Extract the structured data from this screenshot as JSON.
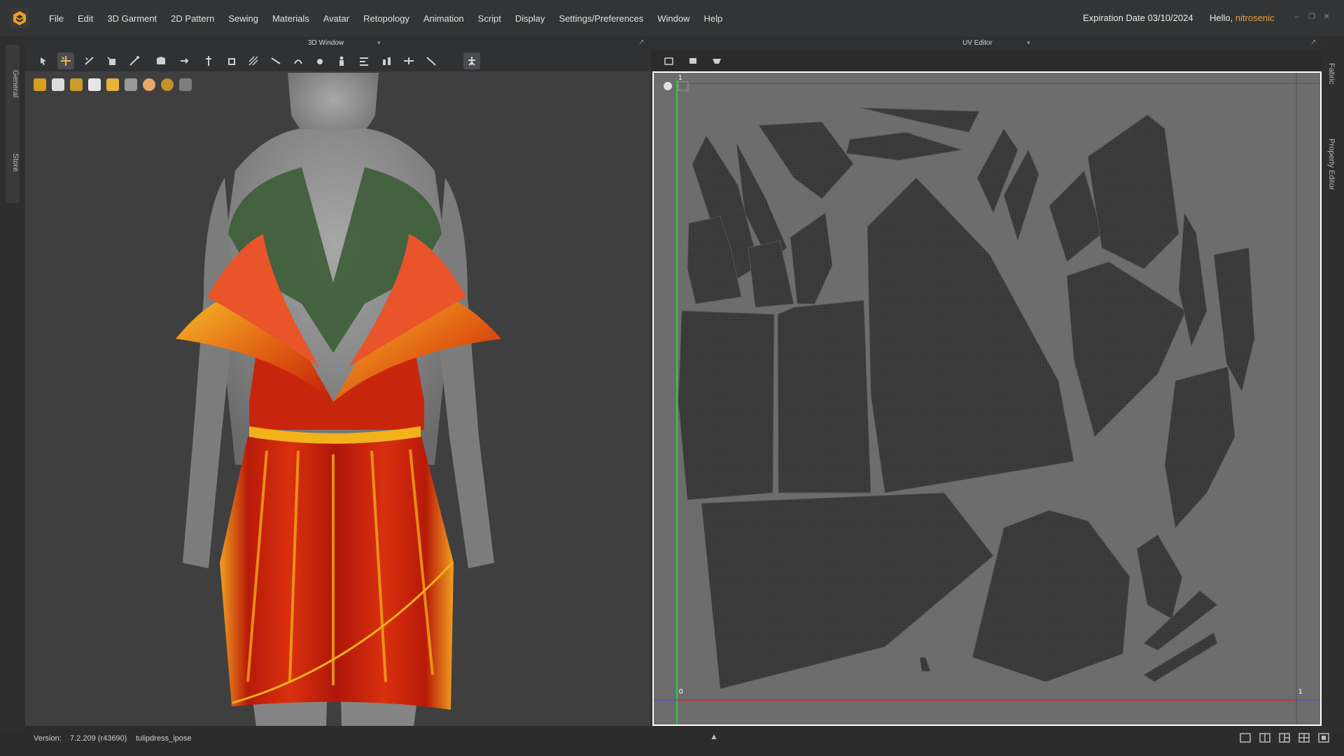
{
  "app": {
    "menu": [
      "File",
      "Edit",
      "3D Garment",
      "2D Pattern",
      "Sewing",
      "Materials",
      "Avatar",
      "Retopology",
      "Animation",
      "Script",
      "Display",
      "Settings/Preferences",
      "Window",
      "Help"
    ],
    "expiration": "Expiration Date 03/10/2024",
    "hello_prefix": "Hello, ",
    "username": "nitrosenic",
    "accent": "#e8a23a"
  },
  "left_tabs": [
    "General",
    "Store"
  ],
  "right_tabs": [
    "Fabric",
    "Property Editor"
  ],
  "window3d": {
    "title": "3D Window",
    "dress_colors": {
      "bodice": "#cf2a10",
      "trim": "#f3b21a",
      "sleeves": "#3e5d3a",
      "skin": "#8c8c8c"
    }
  },
  "uv_editor": {
    "title": "UV Editor",
    "label_top_left": "1",
    "label_bottom_left": "0",
    "label_bottom_right": "1",
    "axis_colors": {
      "v": "#2ecc40",
      "u": "#e02020"
    }
  },
  "status": {
    "version_label": "Version:",
    "version_value": "7.2.209 (r43690)",
    "file": "tulipdress_ipose"
  }
}
